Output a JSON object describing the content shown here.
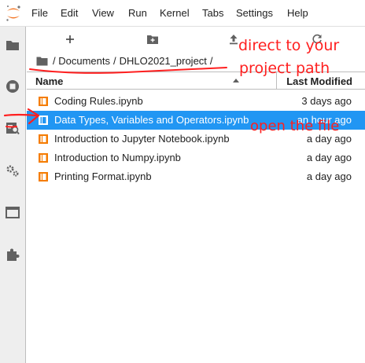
{
  "menubar": {
    "logo": "jupyter-logo",
    "items": [
      "File",
      "Edit",
      "View",
      "Run",
      "Kernel",
      "Tabs",
      "Settings",
      "Help"
    ]
  },
  "activitybar": {
    "icons": [
      "folder-icon",
      "running-sessions-icon",
      "property-inspector-icon",
      "settings-gears-icon",
      "tabs-icon",
      "extensions-puzzle-icon"
    ]
  },
  "toolbar": {
    "icons": [
      "new-launcher-plus-icon",
      "new-folder-icon",
      "upload-icon",
      "refresh-icon"
    ]
  },
  "breadcrumb": {
    "root": "/",
    "parts": [
      "Documents",
      "DHLO2021_project"
    ],
    "separator": "/"
  },
  "file_list": {
    "header_name": "Name",
    "header_modified": "Last Modified",
    "files": [
      {
        "name": "Coding Rules.ipynb",
        "modified": "3 days ago",
        "selected": false
      },
      {
        "name": "Data Types, Variables and Operators.ipynb",
        "modified": "an hour ago",
        "selected": true
      },
      {
        "name": "Introduction to Jupyter Notebook.ipynb",
        "modified": "a day ago",
        "selected": false
      },
      {
        "name": "Introduction to Numpy.ipynb",
        "modified": "a day ago",
        "selected": false
      },
      {
        "name": "Printing Format.ipynb",
        "modified": "a day ago",
        "selected": false
      }
    ]
  },
  "annotations": {
    "line1": "direct to your",
    "line2": "project path",
    "open_file": "open the file",
    "color": "#ff1f1f"
  },
  "colors": {
    "accent": "#2196f3",
    "notebook_icon": "#f57c00",
    "jupyter_orange": "#f37726"
  }
}
